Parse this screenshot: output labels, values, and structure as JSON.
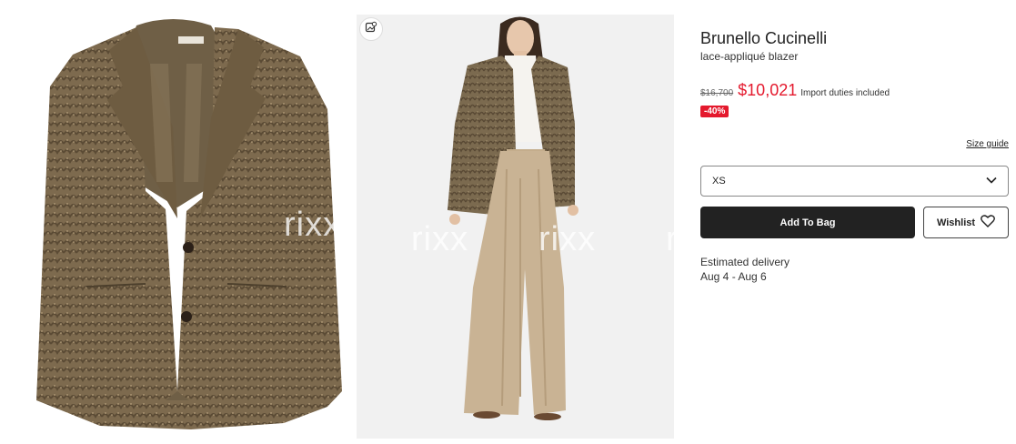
{
  "product": {
    "brand": "Brunello Cucinelli",
    "name": "lace-appliqué blazer",
    "original_price": "$16,700",
    "sale_price": "$10,021",
    "duties_note": "Import duties included",
    "discount_badge": "-40%"
  },
  "size": {
    "guide_label": "Size guide",
    "selected": "XS"
  },
  "actions": {
    "add_to_bag": "Add To Bag",
    "wishlist": "Wishlist"
  },
  "delivery": {
    "label": "Estimated delivery",
    "dates": "Aug 4 - Aug 6"
  },
  "gallery": {
    "watermark": "rixx"
  },
  "colors": {
    "sale_red": "#e4192d",
    "primary_button": "#222222"
  },
  "icons": {
    "ar": "image-search-icon",
    "select": "chevron-down-icon",
    "wishlist": "heart-outline-icon"
  }
}
